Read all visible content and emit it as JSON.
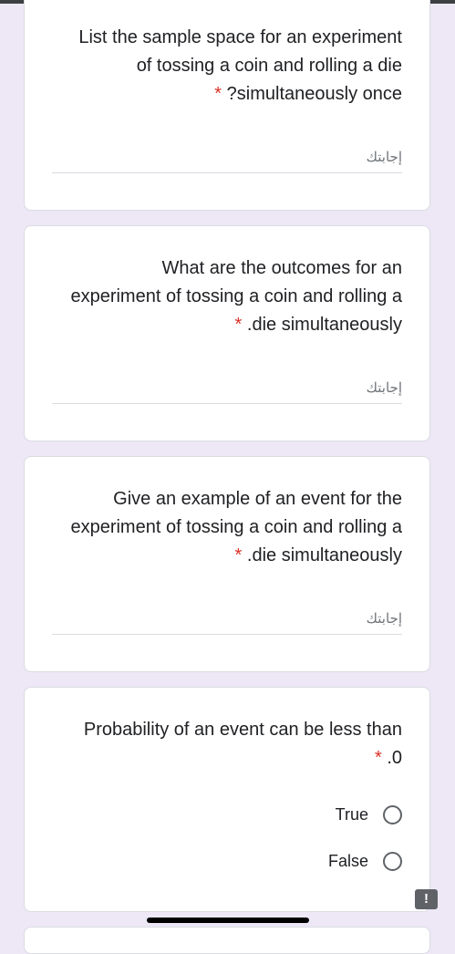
{
  "questions": [
    {
      "lines": [
        "List the sample space for an experiment",
        "of tossing a coin and rolling a die",
        "?simultaneously once"
      ],
      "required_mark": "*",
      "answer_placeholder": "إجابتك"
    },
    {
      "lines": [
        "What are the outcomes for an",
        "experiment of tossing a coin and rolling a",
        ".die simultaneously"
      ],
      "required_mark": "*",
      "answer_placeholder": "إجابتك"
    },
    {
      "lines": [
        "Give an example of an event for the",
        "experiment of tossing a coin and rolling a",
        ".die simultaneously"
      ],
      "required_mark": "*",
      "answer_placeholder": "إجابتك"
    },
    {
      "lines": [
        "Probability of an event can be less than",
        ".0"
      ],
      "required_mark": "*",
      "options": [
        "True",
        "False"
      ]
    }
  ],
  "report_icon": "!",
  "colors": {
    "background": "#ede7f6",
    "required": "#d93025",
    "divider": "#dadce0"
  },
  "icons": {
    "radio": "radio-unchecked-icon",
    "report": "report-problem-icon"
  }
}
